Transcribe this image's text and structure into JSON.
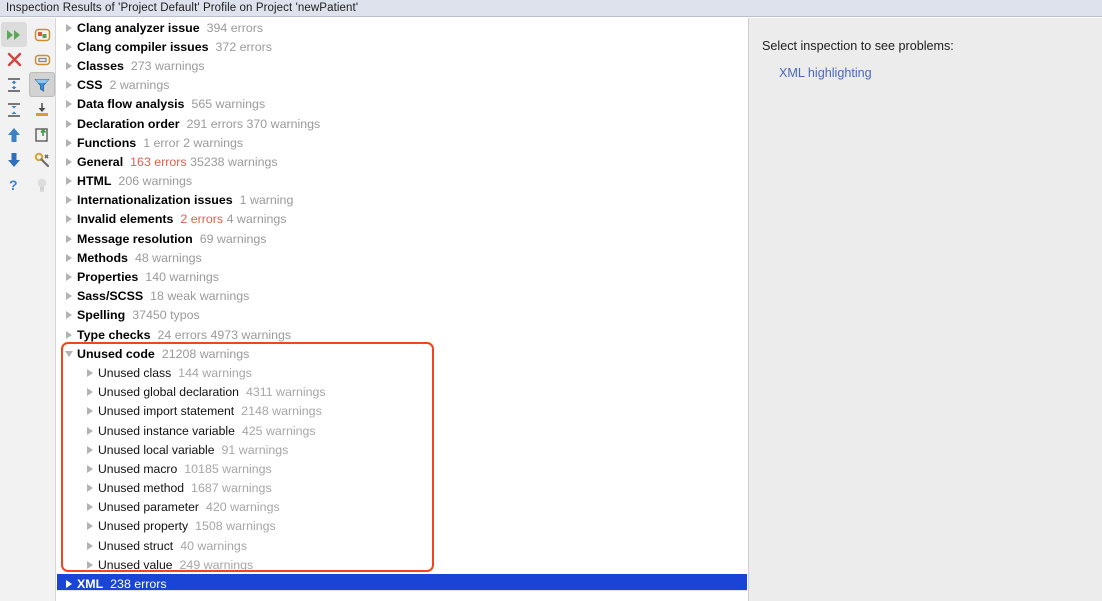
{
  "window": {
    "title": "Inspection Results of 'Project Default' Profile on Project 'newPatient'"
  },
  "toolbar": {
    "left_column": [
      {
        "name": "rerun-inspection-icon",
        "glyph": "double-chevron-right",
        "state": "selected"
      },
      {
        "name": "close-icon",
        "glyph": "x-mark",
        "state": "normal"
      },
      {
        "name": "expand-all-icon",
        "glyph": "expand-all",
        "state": "normal"
      },
      {
        "name": "collapse-all-icon",
        "glyph": "collapse-all",
        "state": "normal"
      },
      {
        "name": "previous-problem-icon",
        "glyph": "arrow-up",
        "state": "normal"
      },
      {
        "name": "next-problem-icon",
        "glyph": "arrow-down",
        "state": "normal"
      },
      {
        "name": "help-icon",
        "glyph": "question-mark",
        "state": "normal"
      }
    ],
    "right_column": [
      {
        "name": "group-by-severity-icon",
        "glyph": "group-severity",
        "state": "normal"
      },
      {
        "name": "group-by-directory-icon",
        "glyph": "group-directory",
        "state": "normal"
      },
      {
        "name": "filter-icon",
        "glyph": "funnel",
        "state": "pressed"
      },
      {
        "name": "export-icon",
        "glyph": "download-tray",
        "state": "normal"
      },
      {
        "name": "export-to-file-icon",
        "glyph": "export-arrow",
        "state": "normal"
      },
      {
        "name": "settings-icon",
        "glyph": "wrench",
        "state": "normal"
      },
      {
        "name": "suggestion-icon",
        "glyph": "lightbulb",
        "state": "disabled"
      }
    ]
  },
  "tree": {
    "selected_index": 20,
    "rows": [
      {
        "label": "Clang analyzer issue",
        "counts": "394 errors",
        "errors": "",
        "expanded": false,
        "level": 0
      },
      {
        "label": "Clang compiler issues",
        "counts": "372 errors",
        "errors": "",
        "expanded": false,
        "level": 0
      },
      {
        "label": "Classes",
        "counts": "273 warnings",
        "errors": "",
        "expanded": false,
        "level": 0
      },
      {
        "label": "CSS",
        "counts": "2 warnings",
        "errors": "",
        "expanded": false,
        "level": 0
      },
      {
        "label": "Data flow analysis",
        "counts": "565 warnings",
        "errors": "",
        "expanded": false,
        "level": 0
      },
      {
        "label": "Declaration order",
        "counts": "291 errors 370 warnings",
        "errors": "",
        "expanded": false,
        "level": 0
      },
      {
        "label": "Functions",
        "counts": "1 error 2 warnings",
        "errors": "",
        "expanded": false,
        "level": 0
      },
      {
        "label": "General",
        "counts": "35238 warnings",
        "errors": "163 errors",
        "expanded": false,
        "level": 0
      },
      {
        "label": "HTML",
        "counts": "206 warnings",
        "errors": "",
        "expanded": false,
        "level": 0
      },
      {
        "label": "Internationalization issues",
        "counts": "1 warning",
        "errors": "",
        "expanded": false,
        "level": 0
      },
      {
        "label": "Invalid elements",
        "counts": "4 warnings",
        "errors": "2 errors",
        "expanded": false,
        "level": 0
      },
      {
        "label": "Message resolution",
        "counts": "69 warnings",
        "errors": "",
        "expanded": false,
        "level": 0
      },
      {
        "label": "Methods",
        "counts": "48 warnings",
        "errors": "",
        "expanded": false,
        "level": 0
      },
      {
        "label": "Properties",
        "counts": "140 warnings",
        "errors": "",
        "expanded": false,
        "level": 0
      },
      {
        "label": "Sass/SCSS",
        "counts": "18 weak warnings",
        "errors": "",
        "expanded": false,
        "level": 0
      },
      {
        "label": "Spelling",
        "counts": "37450 typos",
        "errors": "",
        "expanded": false,
        "level": 0
      },
      {
        "label": "Type checks",
        "counts": "24 errors 4973 warnings",
        "errors": "",
        "expanded": false,
        "level": 0
      },
      {
        "label": "Unused code",
        "counts": "21208 warnings",
        "errors": "",
        "expanded": true,
        "level": 0
      },
      {
        "label": "Unused class",
        "counts": "144 warnings",
        "errors": "",
        "expanded": false,
        "level": 1
      },
      {
        "label": "Unused global declaration",
        "counts": "4311 warnings",
        "errors": "",
        "expanded": false,
        "level": 1
      },
      {
        "label": "Unused import statement",
        "counts": "2148 warnings",
        "errors": "",
        "expanded": false,
        "level": 1
      },
      {
        "label": "Unused instance variable",
        "counts": "425 warnings",
        "errors": "",
        "expanded": false,
        "level": 1
      },
      {
        "label": "Unused local variable",
        "counts": "91 warnings",
        "errors": "",
        "expanded": false,
        "level": 1
      },
      {
        "label": "Unused macro",
        "counts": "10185 warnings",
        "errors": "",
        "expanded": false,
        "level": 1
      },
      {
        "label": "Unused method",
        "counts": "1687 warnings",
        "errors": "",
        "expanded": false,
        "level": 1
      },
      {
        "label": "Unused parameter",
        "counts": "420 warnings",
        "errors": "",
        "expanded": false,
        "level": 1
      },
      {
        "label": "Unused property",
        "counts": "1508 warnings",
        "errors": "",
        "expanded": false,
        "level": 1
      },
      {
        "label": "Unused struct",
        "counts": "40 warnings",
        "errors": "",
        "expanded": false,
        "level": 1
      },
      {
        "label": "Unused value",
        "counts": "249 warnings",
        "errors": "",
        "expanded": false,
        "level": 1
      },
      {
        "label": "XML",
        "counts": "238 errors",
        "errors": "",
        "expanded": false,
        "level": 0,
        "selected": true
      }
    ]
  },
  "details": {
    "hint": "Select inspection to see problems:",
    "link": "XML highlighting"
  },
  "annotation": {
    "name": "red-highlight-box",
    "color": "#f2441f"
  },
  "colors": {
    "selection_blue": "#1a44d6",
    "error_red": "#e0614a",
    "link_blue": "#4a68b8",
    "titlebar": "#dde2ec",
    "detail_panel_bg": "#ececec",
    "toolbar_bg": "#f2f2f2"
  }
}
